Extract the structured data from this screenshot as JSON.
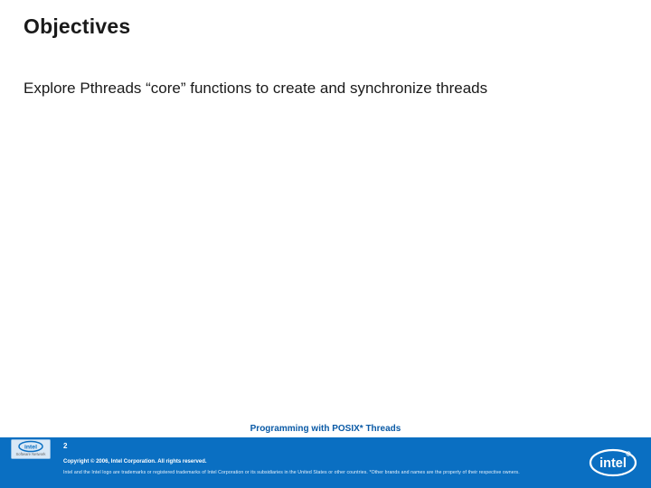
{
  "slide": {
    "title": "Objectives",
    "body": "Explore Pthreads “core” functions to create and synchronize threads",
    "subheader": "Programming with POSIX* Threads"
  },
  "footer": {
    "page_number": "2",
    "copyright": "Copyright © 2006, Intel Corporation. All rights reserved.",
    "disclaimer": "Intel and the Intel logo are trademarks or registered trademarks of Intel Corporation or its subsidiaries in the United States or other countries. *Other brands and names are the property of their respective owners."
  },
  "logos": {
    "left_alt": "intel-software-network-logo",
    "right_alt": "intel-logo",
    "brand_text": "intel",
    "network_text": "Software Network"
  }
}
